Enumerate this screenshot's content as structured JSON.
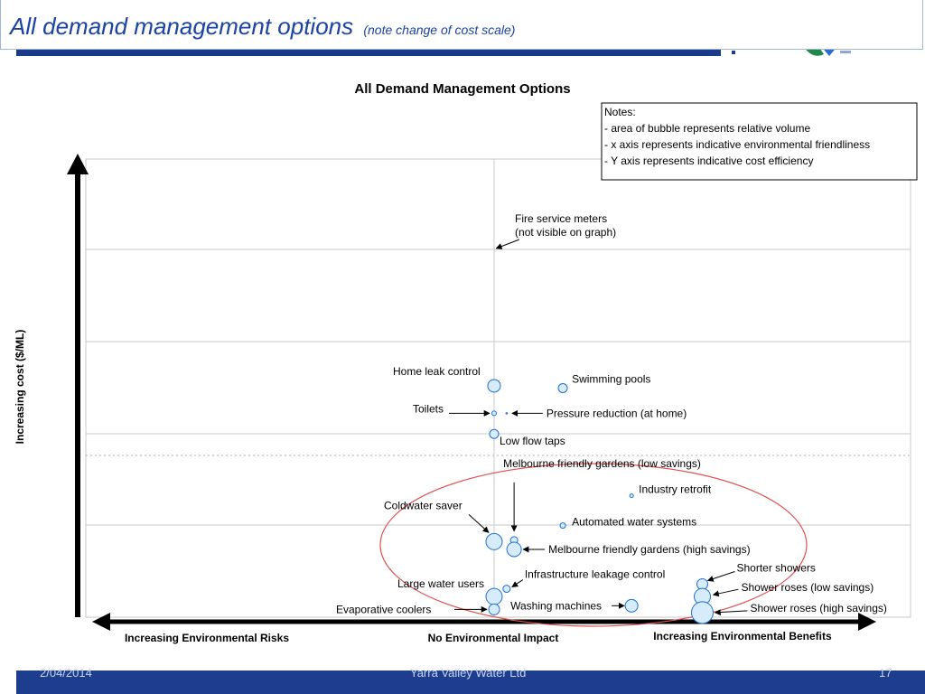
{
  "slide": {
    "title": "All demand management options",
    "title_note": "(note change of cost scale)"
  },
  "footer": {
    "date": "2/04/2014",
    "center": "Yarra Valley Water Ltd",
    "page": "17"
  },
  "chart_data": {
    "type": "scatter",
    "title": "All Demand Management Options",
    "ylabel": "Increasing cost ($/ML)",
    "x_axis_labels": {
      "left": "Increasing Environmental Risks",
      "center": "No Environmental Impact",
      "right": "Increasing Environmental Benefits"
    },
    "xlim": [
      -1,
      1
    ],
    "ylim": [
      0,
      1
    ],
    "grid": true,
    "notes": [
      "Notes:",
      "- area of bubble represents relative volume",
      "- x axis represents indicative environmental friendliness",
      "- Y axis represents indicative cost efficiency"
    ],
    "colors": {
      "bubble_fill": "#d6ecfb",
      "bubble_stroke": "#1f6fd1",
      "grid": "#c8c8c8",
      "highlight_ellipse": "#e05050"
    },
    "points": [
      {
        "label": "Home leak control",
        "x": 0.0,
        "y": 0.505,
        "size": 7
      },
      {
        "label": "Swimming pools",
        "x": 0.165,
        "y": 0.5,
        "size": 5
      },
      {
        "label": "Toilets",
        "x": 0.0,
        "y": 0.445,
        "size": 2.5
      },
      {
        "label": "Pressure reduction (at home)",
        "x": 0.03,
        "y": 0.445,
        "size": 0.8
      },
      {
        "label": "Low flow taps",
        "x": 0.0,
        "y": 0.4,
        "size": 5
      },
      {
        "label": "Industry retrofit",
        "x": 0.33,
        "y": 0.265,
        "size": 2
      },
      {
        "label": "Automated water systems",
        "x": 0.165,
        "y": 0.2,
        "size": 3
      },
      {
        "label": "Coldwater saver",
        "x": 0.0,
        "y": 0.165,
        "size": 9
      },
      {
        "label": "Melbourne friendly gardens (low savings)",
        "x": 0.048,
        "y": 0.168,
        "size": 4
      },
      {
        "label": "Melbourne friendly gardens (high savings)",
        "x": 0.048,
        "y": 0.148,
        "size": 8
      },
      {
        "label": "Infrastructure leakage control",
        "x": 0.03,
        "y": 0.062,
        "size": 4
      },
      {
        "label": "Large water users",
        "x": 0.0,
        "y": 0.045,
        "size": 9
      },
      {
        "label": "Evaporative coolers",
        "x": 0.0,
        "y": 0.017,
        "size": 6
      },
      {
        "label": "Washing machines",
        "x": 0.33,
        "y": 0.025,
        "size": 7
      },
      {
        "label": "Shorter showers",
        "x": 0.5,
        "y": 0.072,
        "size": 6
      },
      {
        "label": "Shower roses (low savings)",
        "x": 0.5,
        "y": 0.045,
        "size": 9
      },
      {
        "label": "Shower roses (high savings)",
        "x": 0.5,
        "y": 0.01,
        "size": 12
      }
    ],
    "annotations": [
      {
        "text": "Fire service meters",
        "x": 0.05,
        "y": 0.87
      },
      {
        "text": "(not visible on graph)",
        "x": 0.05,
        "y": 0.84
      }
    ]
  }
}
